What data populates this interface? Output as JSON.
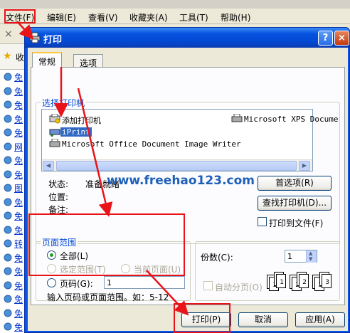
{
  "ie": {
    "menu": [
      "文件(F)",
      "编辑(E)",
      "查看(V)",
      "收藏夹(A)",
      "工具(T)",
      "帮助(H)"
    ],
    "fav_close": "×",
    "fav_label": "收",
    "side_links": [
      "免",
      "免",
      "免",
      "免",
      "免",
      "网",
      "免",
      "免",
      "图",
      "免",
      "免",
      "免",
      "转",
      "免",
      "免",
      "免",
      "免",
      "免",
      "免"
    ]
  },
  "dialog": {
    "title": "打印",
    "help": "?",
    "close": "×",
    "tabs": [
      "常规",
      "选项"
    ],
    "select_printer_group": "选择打印机",
    "printers": [
      "添加打印机",
      "Microsoft XPS Docume",
      "iPrint",
      "Microsoft Office Document Image Writer"
    ],
    "status_label": "状态:",
    "status_value": "准备就绪",
    "location_label": "位置:",
    "comment_label": "备注:",
    "preferences_button": "首选项(R)",
    "find_printer_button": "查找打印机(D)...",
    "print_to_file": "打印到文件(F)",
    "page_range_group": "页面范围",
    "range_all": "全部(L)",
    "range_selection": "选定范围(T)",
    "range_current": "当前页面(U)",
    "range_pages": "页码(G):",
    "pages_value": "1",
    "hint": "输入页码或页面范围。如：5-12",
    "copies_label": "份数(C):",
    "copies_value": "1",
    "collate": "自动分页(O)",
    "collate_numbers": [
      "1",
      "1",
      "2",
      "2",
      "3",
      "3"
    ],
    "print_button": "打印(P)",
    "cancel_button": "取消",
    "apply_button": "应用(A)"
  },
  "watermark": "www.freehao123.com",
  "colors": {
    "title_bar": "#0552de",
    "highlight": "#e8141a",
    "selection": "#316ac5"
  }
}
